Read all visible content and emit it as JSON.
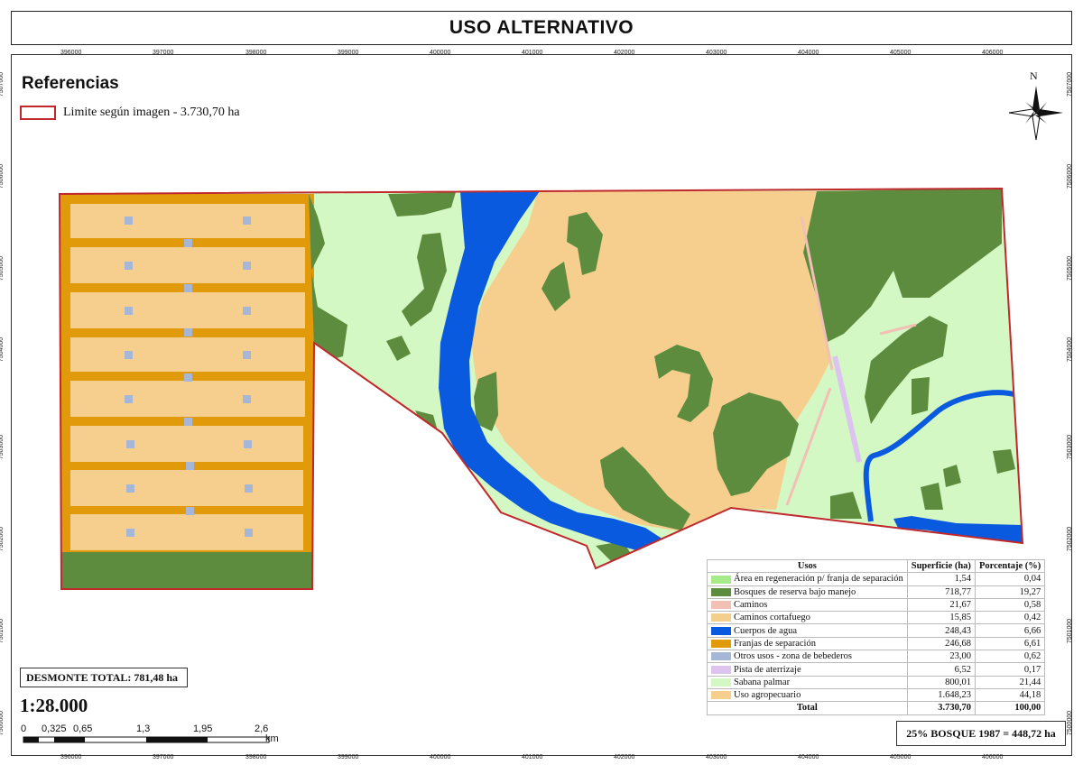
{
  "title": "USO ALTERNATIVO",
  "references": {
    "heading": "Referencias",
    "limit_label": "Limite según imagen - 3.730,70 ha",
    "limit_color": "#c0282c"
  },
  "north_label": "N",
  "grid": {
    "x_labels": [
      "396000",
      "397000",
      "398000",
      "399000",
      "400000",
      "401000",
      "402000",
      "403000",
      "404000",
      "405000",
      "406000"
    ],
    "y_labels": [
      "7507000",
      "7506000",
      "7505000",
      "7504000",
      "7503000",
      "7502000",
      "7501000",
      "7500000"
    ]
  },
  "legend": {
    "headers": [
      "Usos",
      "Superficie (ha)",
      "Porcentaje (%)"
    ],
    "rows": [
      {
        "name": "Área en regeneración p/ franja de separación",
        "area": "1,54",
        "pct": "0,04",
        "color": "#a6ea8a"
      },
      {
        "name": "Bosques de reserva bajo manejo",
        "area": "718,77",
        "pct": "19,27",
        "color": "#5e8c3e"
      },
      {
        "name": "Caminos",
        "area": "21,67",
        "pct": "0,58",
        "color": "#f2c0b4"
      },
      {
        "name": "Caminos cortafuego",
        "area": "15,85",
        "pct": "0,42",
        "color": "#f2cf8c"
      },
      {
        "name": "Cuerpos de agua",
        "area": "248,43",
        "pct": "6,66",
        "color": "#0a5ae0"
      },
      {
        "name": "Franjas de separación",
        "area": "246,68",
        "pct": "6,61",
        "color": "#e09a0a"
      },
      {
        "name": "Otros usos - zona de bebederos",
        "area": "23,00",
        "pct": "0,62",
        "color": "#a6b6d6"
      },
      {
        "name": "Pista de aterrizaje",
        "area": "6,52",
        "pct": "0,17",
        "color": "#dcc4ee"
      },
      {
        "name": "Sabana palmar",
        "area": "800,01",
        "pct": "21,44",
        "color": "#d4f8c4"
      },
      {
        "name": "Uso agropecuario",
        "area": "1.648,23",
        "pct": "44,18",
        "color": "#f6cf8e"
      }
    ],
    "total_label": "Total",
    "total_area": "3.730,70",
    "total_pct": "100,00"
  },
  "desmonte": "DESMONTE TOTAL: 781,48 ha",
  "scale": "1:28.000",
  "scalebar": {
    "labels": [
      "0",
      "0,325",
      "0,65",
      "1,3",
      "1,95",
      "2,6"
    ],
    "unit": "km"
  },
  "bosque_note": "25% BOSQUE 1987 = 448,72 ha"
}
